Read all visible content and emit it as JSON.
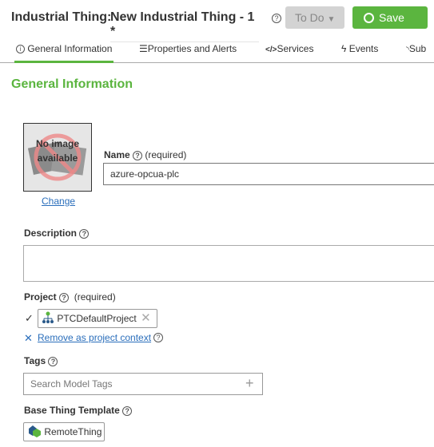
{
  "header": {
    "type_label": "Industrial Thing:",
    "name": "New Industrial Thing - 1 *",
    "state_label": "To Do",
    "save_label": "Save"
  },
  "tabs": [
    {
      "label": "General Information",
      "icon": "info-icon"
    },
    {
      "label": "Properties and Alerts",
      "icon": "list-icon"
    },
    {
      "label": "Services",
      "icon": "code-icon"
    },
    {
      "label": "Events",
      "icon": "lightning-icon"
    },
    {
      "label": "Sub",
      "icon": "rss-icon"
    }
  ],
  "section_title": "General Information",
  "image": {
    "placeholder": "No image available",
    "change_label": "Change"
  },
  "name_field": {
    "label": "Name",
    "required": "(required)",
    "value": "azure-opcua-plc"
  },
  "description": {
    "label": "Description",
    "value": ""
  },
  "project": {
    "label": "Project",
    "required": "(required)",
    "value": "PTCDefaultProject",
    "remove_label": "Remove as project context"
  },
  "tags": {
    "label": "Tags",
    "placeholder": "Search Model Tags"
  },
  "base_template": {
    "label": "Base Thing Template",
    "value": "RemoteThing"
  },
  "colors": {
    "accent": "#5bb53f",
    "link": "#2a6ebb"
  }
}
